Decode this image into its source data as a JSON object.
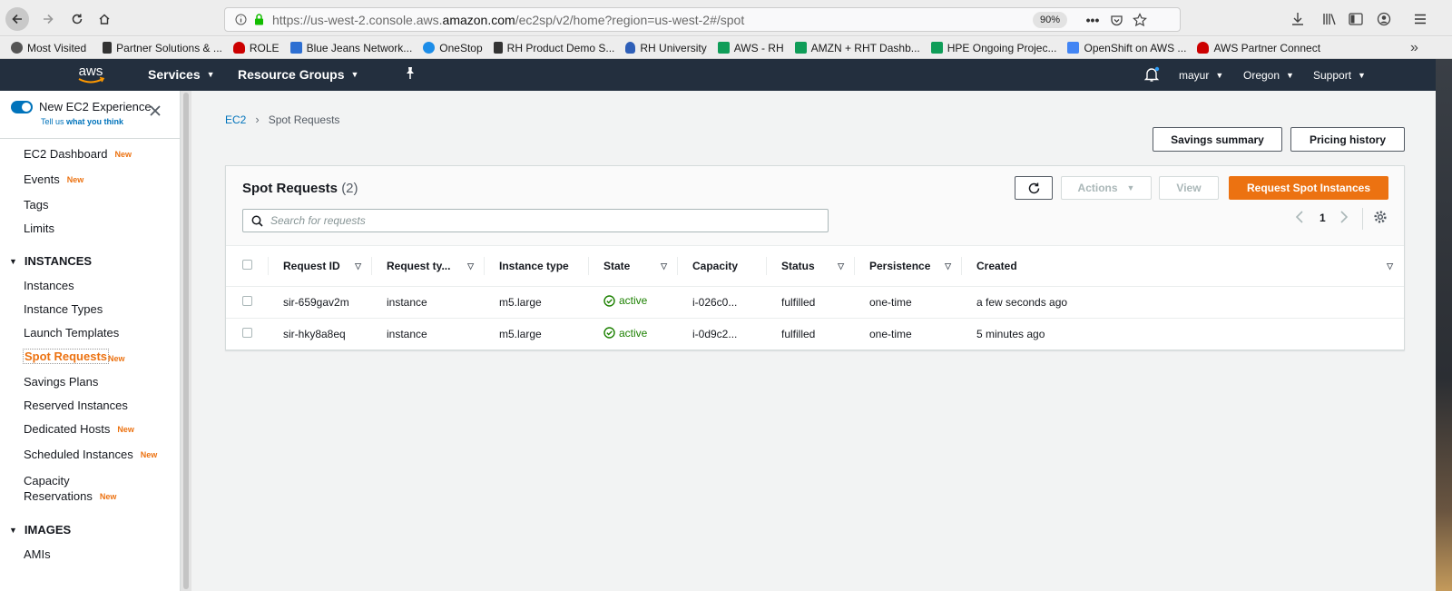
{
  "browser": {
    "url_prefix": "https://us-west-2.console.aws.",
    "url_domain": "amazon.com",
    "url_suffix": "/ec2sp/v2/home?region=us-west-2#/spot",
    "zoom": "90%"
  },
  "bookmarks": [
    {
      "label": "Most Visited",
      "icon": "gear-icon"
    },
    {
      "label": "Partner Solutions & ...",
      "icon": "page-icon"
    },
    {
      "label": "ROLE",
      "icon": "redhat-icon"
    },
    {
      "label": "Blue Jeans Network...",
      "icon": "bluejeans-icon"
    },
    {
      "label": "OneStop",
      "icon": "globe-icon"
    },
    {
      "label": "RH Product Demo S...",
      "icon": "page-icon"
    },
    {
      "label": "RH University",
      "icon": "bulb-icon"
    },
    {
      "label": "AWS - RH",
      "icon": "sheet-icon"
    },
    {
      "label": "AMZN + RHT Dashb...",
      "icon": "sheet-icon"
    },
    {
      "label": "HPE Ongoing Projec...",
      "icon": "sheet-icon"
    },
    {
      "label": "OpenShift on AWS ...",
      "icon": "doc-icon"
    },
    {
      "label": "AWS Partner Connect",
      "icon": "redhat-icon"
    }
  ],
  "header": {
    "logo": "aws",
    "services": "Services",
    "resource_groups": "Resource Groups",
    "user": "mayur",
    "region": "Oregon",
    "support": "Support"
  },
  "sidebar": {
    "new_experience_title": "New EC2 Experience",
    "tell_us": "Tell us",
    "what_you_think": "what you think",
    "new_badge": "New",
    "items_top": [
      "EC2 Dashboard",
      "Events",
      "Tags",
      "Limits"
    ],
    "section_instances": "INSTANCES",
    "instances_items": [
      "Instances",
      "Instance Types",
      "Launch Templates",
      "Spot Requests",
      "Savings Plans",
      "Reserved Instances",
      "Dedicated Hosts",
      "Scheduled Instances"
    ],
    "capacity_line1": "Capacity",
    "capacity_line2": "Reservations",
    "section_images": "IMAGES",
    "images_items": [
      "AMIs"
    ]
  },
  "breadcrumb": {
    "root": "EC2",
    "current": "Spot Requests"
  },
  "top_buttons": {
    "savings_summary": "Savings summary",
    "pricing_history": "Pricing history"
  },
  "panel": {
    "title": "Spot Requests",
    "count": "(2)",
    "actions": "Actions",
    "view": "View",
    "request_spot": "Request Spot Instances",
    "search_placeholder": "Search for requests",
    "page": "1"
  },
  "table": {
    "columns": [
      "Request ID",
      "Request ty...",
      "Instance type",
      "State",
      "Capacity",
      "Status",
      "Persistence",
      "Created"
    ],
    "rows": [
      {
        "request_id": "sir-659gav2m",
        "request_type": "instance",
        "instance_type": "m5.large",
        "state": "active",
        "capacity": "i-026c0...",
        "status": "fulfilled",
        "persistence": "one-time",
        "created": "a few seconds ago"
      },
      {
        "request_id": "sir-hky8a8eq",
        "request_type": "instance",
        "instance_type": "m5.large",
        "state": "active",
        "capacity": "i-0d9c2...",
        "status": "fulfilled",
        "persistence": "one-time",
        "created": "5 minutes ago"
      }
    ]
  },
  "colors": {
    "accent": "#ec7211",
    "link": "#0073bb",
    "success": "#1d8102",
    "header_bg": "#232f3e"
  }
}
